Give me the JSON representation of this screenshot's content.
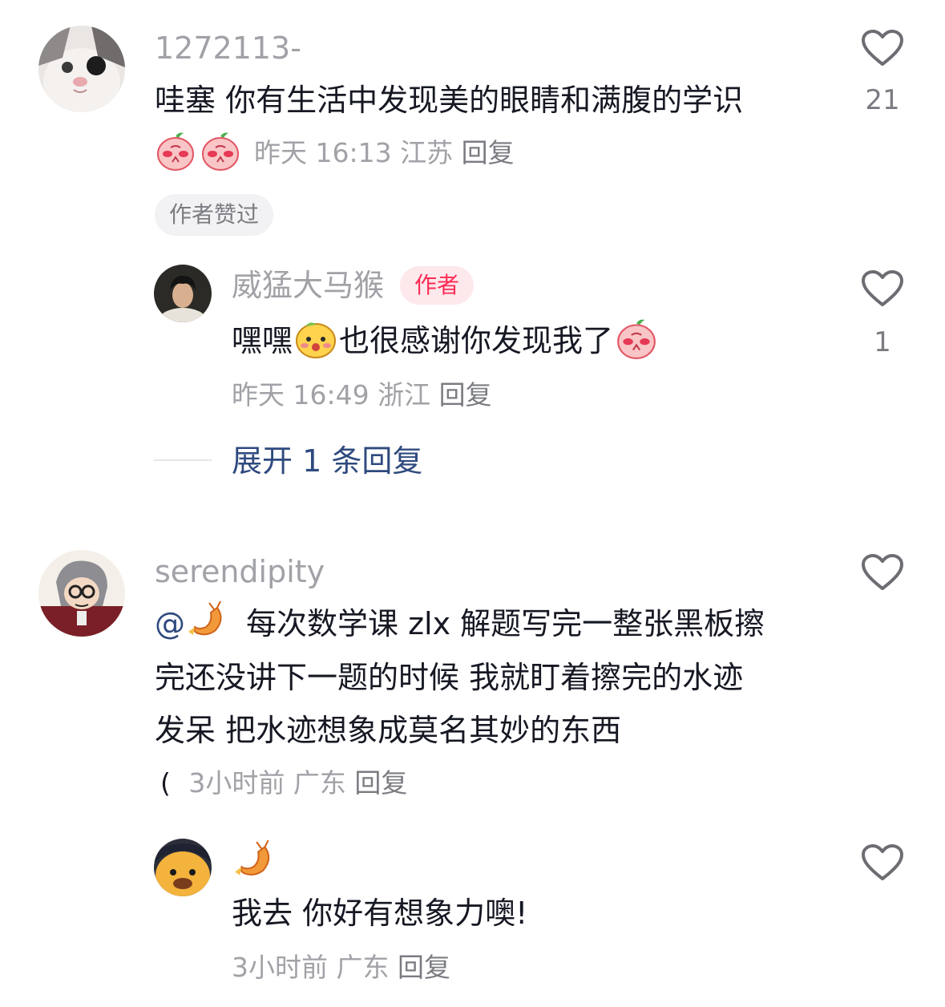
{
  "comments": [
    {
      "username": "1272113-",
      "text": "哇塞 你有生活中发现美的眼睛和满腹的学识",
      "time": "昨天 16:13",
      "location": "江苏",
      "reply_label": "回复",
      "like_count": "21",
      "badge": "作者赞过",
      "avatar": "cat-avatar",
      "emojis": [
        "peach-pray-emoji",
        "peach-pray-emoji"
      ]
    },
    {
      "username": "威猛大马猴",
      "tag": "作者",
      "text_prefix": "嘿嘿",
      "text_suffix": "也很感谢你发现我了",
      "time": "昨天 16:49",
      "location": "浙江",
      "reply_label": "回复",
      "like_count": "1",
      "avatar": "person-avatar",
      "emojis": [
        "yellow-blush-emoji",
        "peach-pray-emoji"
      ]
    },
    {
      "expand_label": "展开 1 条回复"
    },
    {
      "username": "serendipity",
      "mention": "@",
      "line1": "每次数学课 zlx 解题写完一整张黑板擦",
      "line2": "完还没讲下一题的时候  我就盯着擦完的水迹",
      "line3": "发呆 把水迹想象成莫名其妙的东西",
      "line4_prefix": "(",
      "time": "3小时前",
      "location": "广东",
      "reply_label": "回复",
      "avatar": "anime-avatar",
      "emojis": [
        "shrimp-emoji"
      ]
    },
    {
      "username_emoji": "shrimp-emoji",
      "text": "我去 你好有想象力噢!",
      "time": "3小时前",
      "location": "广东",
      "reply_label": "回复",
      "avatar": "cartoon-avatar"
    }
  ],
  "colors": {
    "name": "#a1a2a7",
    "text": "#161823",
    "expand": "#2f4a7f",
    "author_tag": "#fe2c55"
  }
}
